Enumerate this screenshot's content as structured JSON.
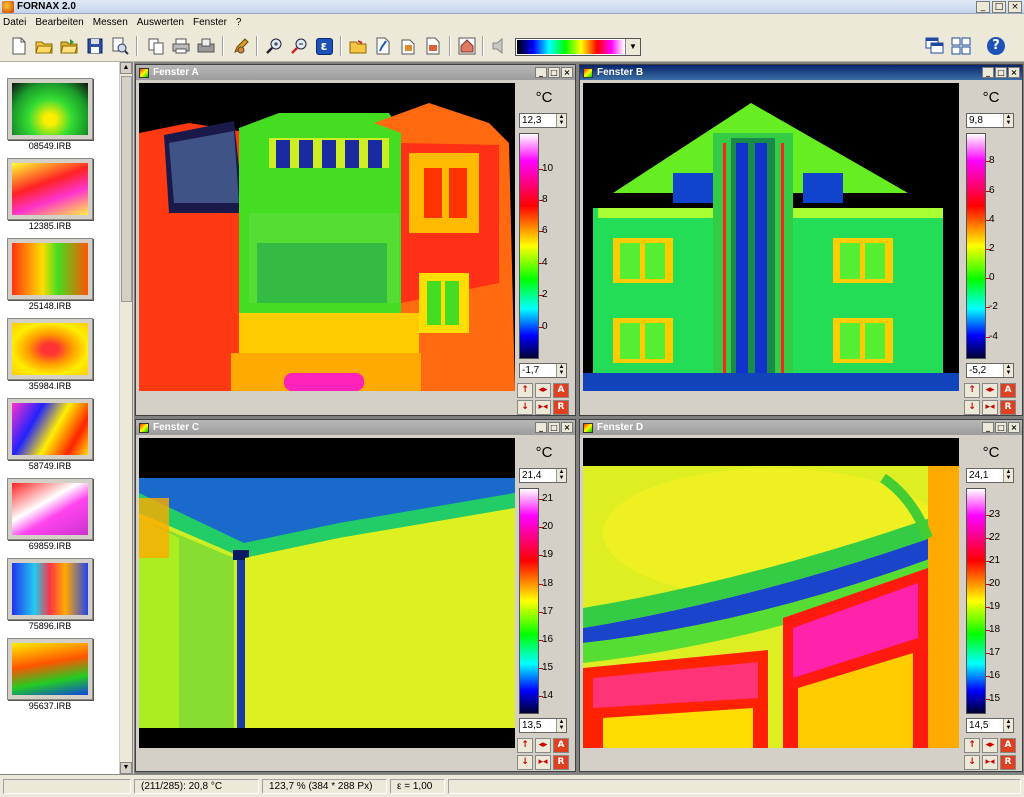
{
  "app": {
    "title": "FORNAX 2.0"
  },
  "menu": [
    "Datei",
    "Bearbeiten",
    "Messen",
    "Auswerten",
    "Fenster",
    "?"
  ],
  "toolbar": {
    "icons": [
      "new-file-icon",
      "open-folder-icon",
      "open-folder-alt-icon",
      "save-icon",
      "print-preview-icon",
      "copy-icon",
      "print-icon",
      "fax-icon",
      "pen-icon",
      "zoom-in-icon",
      "zoom-out-icon",
      "emissivity-icon",
      "folder-icon",
      "paint-icon",
      "paste-icon",
      "report-icon",
      "house-icon",
      "sound-icon",
      "cascade-windows-icon",
      "tile-windows-icon",
      "help-icon"
    ],
    "emissivity_glyph": "ε",
    "help_glyph": "?"
  },
  "thumbnails": [
    {
      "label": "08549.IRB"
    },
    {
      "label": "12385.IRB"
    },
    {
      "label": "25148.IRB"
    },
    {
      "label": "35984.IRB"
    },
    {
      "label": "58749.IRB"
    },
    {
      "label": "69859.IRB"
    },
    {
      "label": "75896.IRB"
    },
    {
      "label": "95637.IRB"
    }
  ],
  "windows": {
    "a": {
      "title": "Fenster A",
      "unit": "°C",
      "max": "12,3",
      "min": "-1,7",
      "ticks": [
        "10",
        "8",
        "6",
        "4",
        "2",
        "0"
      ]
    },
    "b": {
      "title": "Fenster B",
      "unit": "°C",
      "max": "9,8",
      "min": "-5,2",
      "ticks": [
        "8",
        "6",
        "4",
        "2",
        "0",
        "-2",
        "-4"
      ]
    },
    "c": {
      "title": "Fenster C",
      "unit": "°C",
      "max": "21,4",
      "min": "13,5",
      "ticks": [
        "21",
        "20",
        "19",
        "18",
        "17",
        "16",
        "15",
        "14"
      ]
    },
    "d": {
      "title": "Fenster D",
      "unit": "°C",
      "max": "24,1",
      "min": "14,5",
      "ticks": [
        "23",
        "22",
        "21",
        "20",
        "19",
        "18",
        "17",
        "16",
        "15"
      ]
    }
  },
  "status": {
    "position": "(211/285): 20,8 °C",
    "zoom": "123,7 %  (384 * 288 Px)",
    "emissivity": "ε = 1,00"
  },
  "colors": {
    "active_title": "#0a246a",
    "inactive_title": "#9c9c9c",
    "accent_red": "#cc0000"
  }
}
